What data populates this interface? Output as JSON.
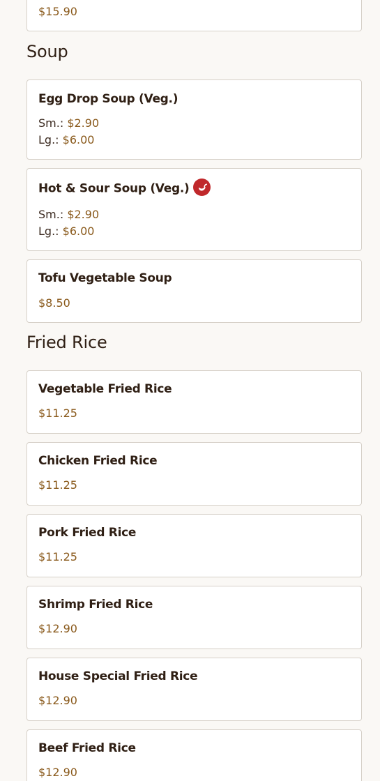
{
  "sections": {
    "prev_card": {
      "price": "$15.90"
    },
    "soup": {
      "title": "Soup",
      "items": [
        {
          "name": "Egg Drop Soup (Veg.)",
          "sm_label": "Sm.:",
          "sm_price": "$2.90",
          "lg_label": "Lg.:",
          "lg_price": "$6.00"
        },
        {
          "name": "Hot & Sour Soup (Veg.)",
          "spicy_icon": "chili-pepper-icon",
          "sm_label": "Sm.:",
          "sm_price": "$2.90",
          "lg_label": "Lg.:",
          "lg_price": "$6.00"
        },
        {
          "name": "Tofu Vegetable Soup",
          "price": "$8.50"
        }
      ]
    },
    "fried_rice": {
      "title": "Fried Rice",
      "items": [
        {
          "name": "Vegetable Fried Rice",
          "price": "$11.25"
        },
        {
          "name": "Chicken Fried Rice",
          "price": "$11.25"
        },
        {
          "name": "Pork Fried Rice",
          "price": "$11.25"
        },
        {
          "name": "Shrimp Fried Rice",
          "price": "$12.90"
        },
        {
          "name": "House Special Fried Rice",
          "price": "$12.90"
        },
        {
          "name": "Beef Fried Rice",
          "price": "$12.90"
        }
      ]
    }
  },
  "colors": {
    "price": "#8a5a1c",
    "spicy": "#c0282b"
  }
}
